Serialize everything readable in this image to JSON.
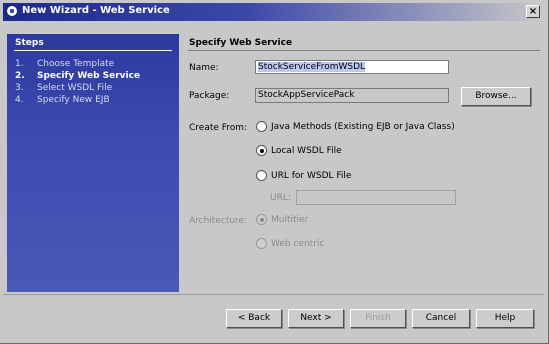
{
  "window": {
    "title": "New Wizard - Web Service",
    "close_glyph": "×"
  },
  "steps": {
    "heading": "Steps",
    "items": [
      {
        "num": "1.",
        "label": "Choose Template"
      },
      {
        "num": "2.",
        "label": "Specify Web Service"
      },
      {
        "num": "3.",
        "label": "Select WSDL File"
      },
      {
        "num": "4.",
        "label": "Specify New EJB"
      }
    ]
  },
  "panel": {
    "heading": "Specify Web Service",
    "name_label": "Name:",
    "name_value": "StockServiceFromWSDL",
    "package_label": "Package:",
    "package_value": "StockAppServicePack",
    "browse_label": "Browse...",
    "create_from_label": "Create From:",
    "options": {
      "java_methods": "Java Methods (Existing EJB or Java Class)",
      "local_wsdl": "Local WSDL File",
      "url_wsdl": "URL for WSDL File"
    },
    "url_label": "URL:",
    "url_value": "",
    "architecture_label": "Architecture:",
    "arch_options": {
      "multitier": "Multitier",
      "web_centric": "Web centric"
    }
  },
  "buttons": {
    "back": "< Back",
    "next": "Next >",
    "finish": "Finish",
    "cancel": "Cancel",
    "help": "Help"
  },
  "colors": {
    "steps_bg": "#3d4bb0",
    "titlebar": "#1c2a8c",
    "selection": "#bcc8f4"
  }
}
